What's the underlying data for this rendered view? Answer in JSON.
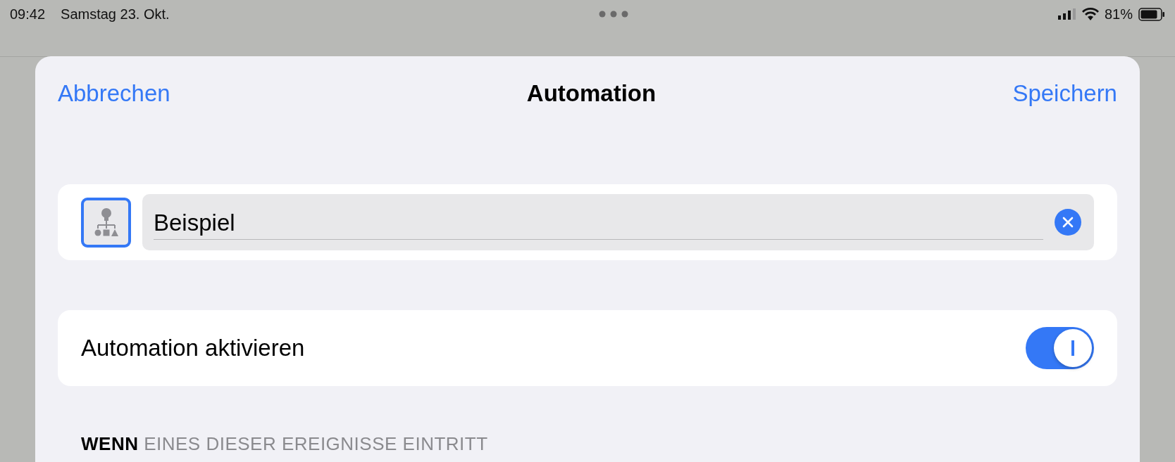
{
  "status_bar": {
    "time": "09:42",
    "date": "Samstag 23. Okt.",
    "battery": "81%"
  },
  "sheet": {
    "cancel": "Abbrechen",
    "title": "Automation",
    "save": "Speichern"
  },
  "name_field": {
    "value": "Beispiel"
  },
  "toggle": {
    "label": "Automation aktivieren",
    "on": true
  },
  "section": {
    "header": "**WENN** EINES DIESER EREIGNISSE EINTRITT"
  }
}
